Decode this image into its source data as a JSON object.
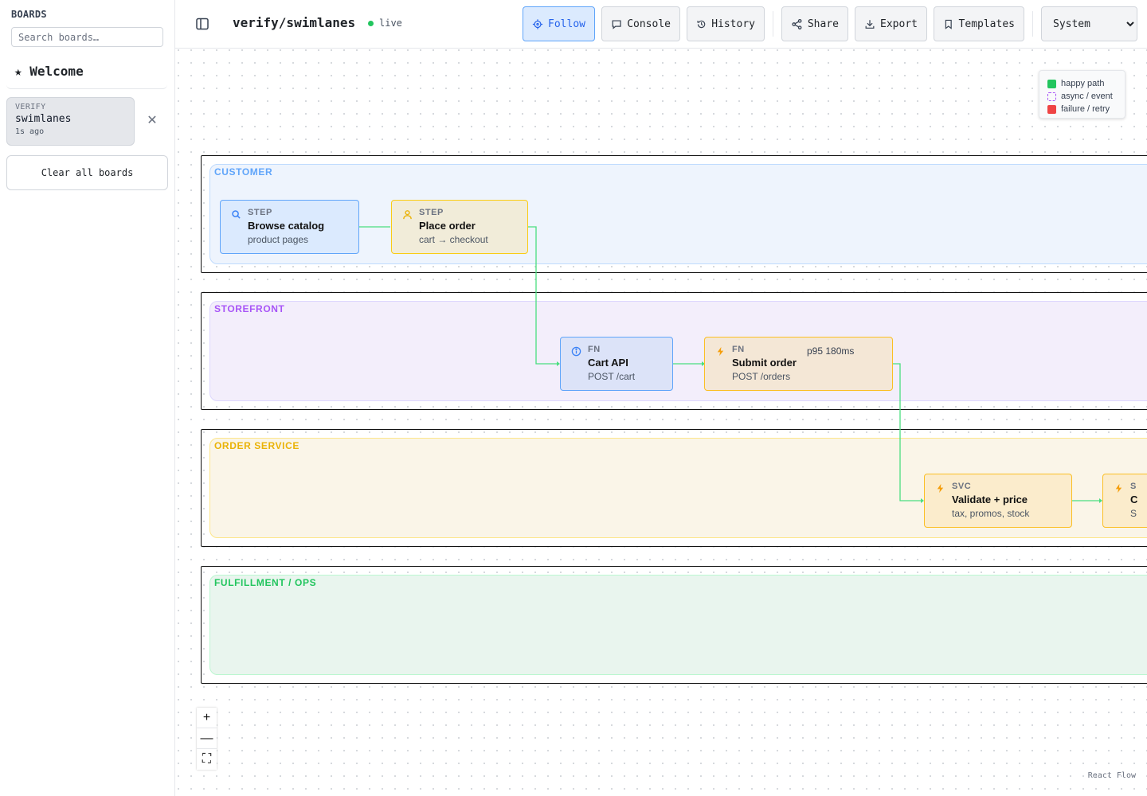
{
  "sidebar": {
    "title": "BOARDS",
    "search_placeholder": "Search boards…",
    "welcome": "★ Welcome",
    "board": {
      "tag": "VERIFY",
      "name": "swimlanes",
      "time": "1s ago"
    },
    "close_glyph": "✕",
    "clear_label": "Clear all boards"
  },
  "header": {
    "title": "verify/swimlanes",
    "status": "live",
    "buttons": {
      "follow": "Follow",
      "console": "Console",
      "history": "History",
      "share": "Share",
      "export": "Export",
      "templates": "Templates"
    },
    "theme": {
      "selected": "System"
    }
  },
  "legend": [
    {
      "label": "happy path",
      "color": "#22c55e",
      "style": "solid"
    },
    {
      "label": "async / event",
      "color": "#a855f7",
      "style": "dashed"
    },
    {
      "label": "failure / retry",
      "color": "#ef4444",
      "style": "solid"
    }
  ],
  "lanes": [
    {
      "label": "CUSTOMER",
      "color": "#60a5fa"
    },
    {
      "label": "STOREFRONT",
      "color": "#a855f7"
    },
    {
      "label": "ORDER SERVICE",
      "color": "#eab308"
    },
    {
      "label": "FULFILLMENT / OPS",
      "color": "#22c55e"
    }
  ],
  "nodes": {
    "browse": {
      "kind": "STEP",
      "title": "Browse catalog",
      "sub": "product pages",
      "icon": "search-icon"
    },
    "place": {
      "kind": "STEP",
      "title": "Place order",
      "sub": "cart → checkout",
      "icon": "user-icon"
    },
    "cart": {
      "kind": "FN",
      "title": "Cart API",
      "sub": "POST /cart",
      "icon": "info-icon"
    },
    "submit": {
      "kind": "FN",
      "title": "Submit order",
      "sub": "POST /orders",
      "metric": "p95 180ms",
      "icon": "bolt-icon"
    },
    "validate": {
      "kind": "SVC",
      "title": "Validate + price",
      "sub": "tax, promos, stock",
      "icon": "bolt-icon"
    },
    "partial": {
      "kind": "S",
      "title": "C",
      "sub": "S",
      "icon": "bolt-icon"
    }
  },
  "controls": {
    "zoom_in": "+",
    "zoom_out": "—",
    "fit": "⛶"
  },
  "attribution": "React Flow",
  "colors": {
    "accent": "#2563eb",
    "edge": "#4ade80"
  }
}
